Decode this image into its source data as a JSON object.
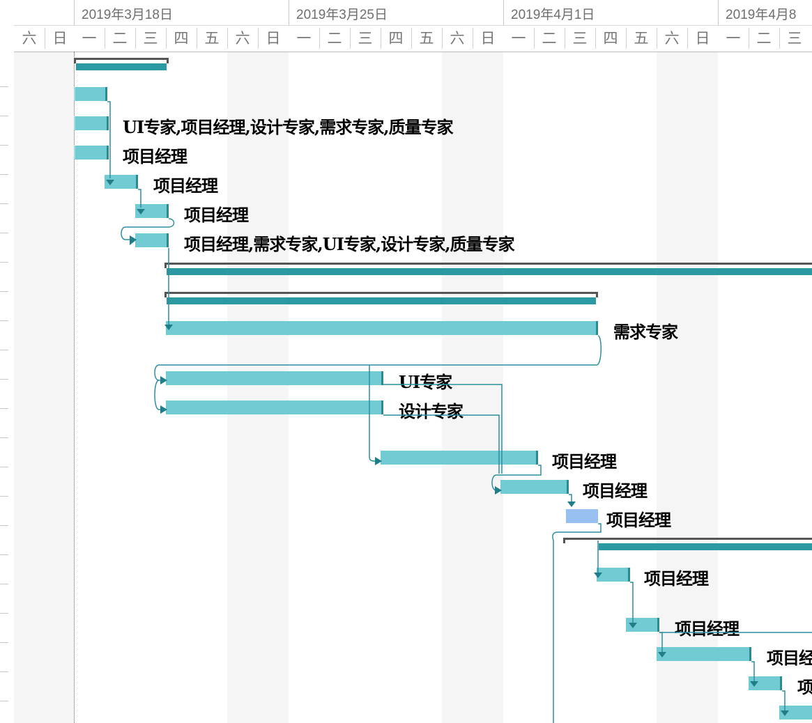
{
  "timeline": {
    "weeks": [
      "2019年3月18日",
      "2019年3月25日",
      "2019年4月1日",
      "2019年4月8"
    ],
    "days_first": [
      "六",
      "日"
    ],
    "days_week": [
      "一",
      "二",
      "三",
      "四",
      "五",
      "六",
      "日"
    ]
  },
  "tasks": {
    "t3": {
      "resource": "UI专家,项目经理,设计专家,需求专家,质量专家"
    },
    "t4": {
      "resource": "项目经理"
    },
    "t5": {
      "resource": "项目经理"
    },
    "t6": {
      "resource": "项目经理"
    },
    "t7": {
      "resource": "项目经理,需求专家,UI专家,设计专家,质量专家"
    },
    "t10": {
      "resource": "需求专家"
    },
    "t11": {
      "resource": "UI专家"
    },
    "t12": {
      "resource": "设计专家"
    },
    "t13": {
      "resource": "项目经理"
    },
    "t14": {
      "resource": "项目经理"
    },
    "t15": {
      "resource": "项目经理"
    },
    "t17": {
      "resource": "项目经理"
    },
    "t18": {
      "resource": "项目经理"
    },
    "t19": {
      "resource": "项目经"
    },
    "t20": {
      "resource": "项"
    }
  },
  "colors": {
    "task_bar": "#72cbd2",
    "task_end": "#2c8a91",
    "summary_fill": "#2a99a1",
    "summary_border": "#555555",
    "selected_bar": "#97bff0",
    "link_line": "#2b8ea0",
    "weekend_shade": "#f5f5f5"
  }
}
